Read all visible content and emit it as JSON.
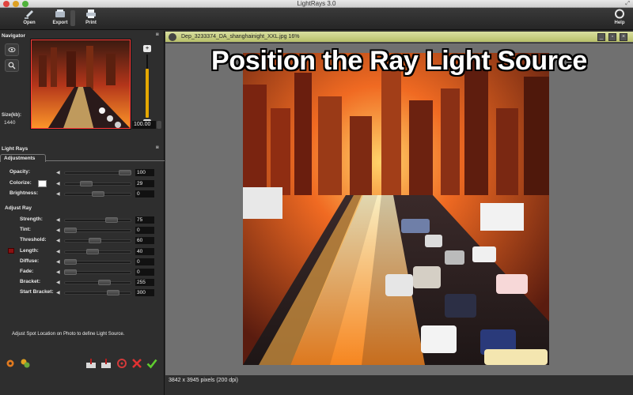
{
  "window": {
    "title": "LightRays 3.0"
  },
  "toolbar": {
    "open": "Open",
    "export": "Export",
    "print": "Print",
    "help": "Help"
  },
  "navigator": {
    "title": "Navigator",
    "size_label": "Size(kb):",
    "size_value": "1440",
    "zoom_value": "100.00",
    "zoom_fraction": 0.78
  },
  "lightrays": {
    "panel_title": "Light Rays",
    "tab": "Adjustments",
    "adjustments": [
      {
        "label": "Opacity:",
        "value": "100",
        "pos": 1.0
      },
      {
        "label": "Colorize:",
        "value": "29",
        "pos": 0.29,
        "swatch": "#ffffff"
      },
      {
        "label": "Brightness:",
        "value": "0",
        "pos": 0.5
      }
    ],
    "adjust_ray_title": "Adjust Ray",
    "ray": [
      {
        "label": "Strength:",
        "value": "75",
        "pos": 0.75
      },
      {
        "label": "Tint:",
        "value": "0",
        "pos": 0.0
      },
      {
        "label": "Threshold:",
        "value": "60",
        "pos": 0.45
      },
      {
        "label": "Length:",
        "value": "40",
        "pos": 0.4
      },
      {
        "label": "Diffuse:",
        "value": "0",
        "pos": 0.0
      },
      {
        "label": "Fade:",
        "value": "0",
        "pos": 0.0
      },
      {
        "label": "Bracket:",
        "value": "255",
        "pos": 0.62
      },
      {
        "label": "Start Bracket:",
        "value": "300",
        "pos": 0.78
      }
    ],
    "hint": "Adjust Spot Location on Photo to define Light Source."
  },
  "document": {
    "title": "Dep_3233374_DA_shanghainight_XXL.jpg 16%",
    "overlay_title": "Position the Ray Light Source",
    "status": "3842 x 3945 pixels (200 dpi)"
  },
  "colors": {
    "accent": "#e6a800",
    "docbar": "#c8cf85",
    "panel": "#2e2e2e"
  }
}
